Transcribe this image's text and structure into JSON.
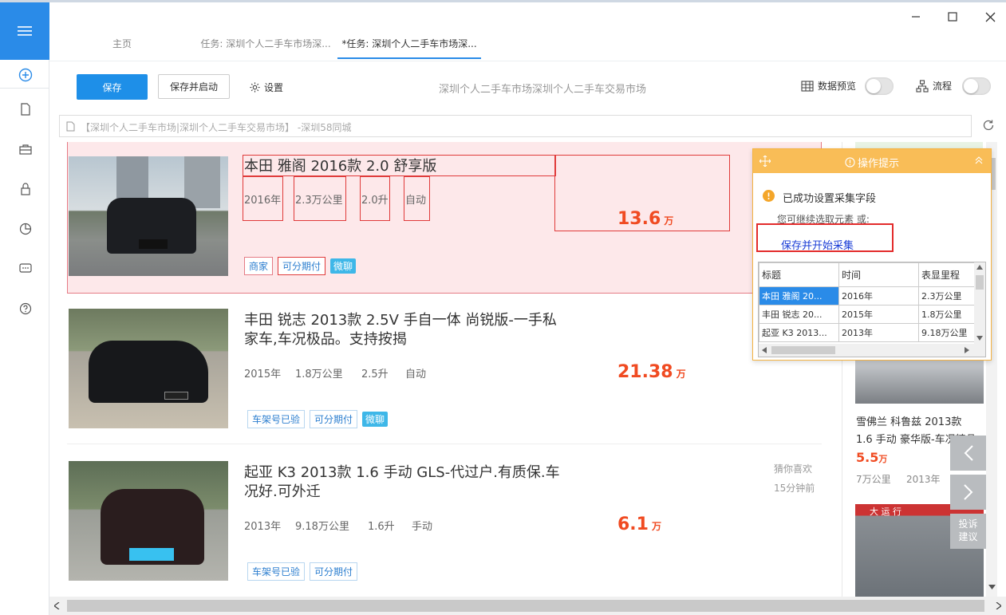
{
  "tabs": {
    "home": "主页",
    "task1": "任务: 深圳个人二手车市场深...",
    "task2": "*任务: 深圳个人二手车市场深..."
  },
  "toolbar": {
    "save_label": "保存",
    "save_start_label": "保存并启动",
    "settings_label": "设置",
    "title": "深圳个人二手车市场深圳个人二手车交易市场",
    "data_preview_label": "数据预览",
    "flow_label": "流程"
  },
  "address": {
    "url_text": "【深圳个人二手车市场|深圳个人二手车交易市场】 -深圳58同城"
  },
  "listings": [
    {
      "title": "本田 雅阁 2016款 2.0 舒享版",
      "year": "2016年",
      "mileage": "2.3万公里",
      "engine": "2.0升",
      "transmission": "自动",
      "price": "13.6",
      "price_unit": "万",
      "tags": [
        "商家",
        "可分期付"
      ],
      "wechat": "微聊"
    },
    {
      "title_line1": "丰田 锐志 2013款 2.5V 手自一体 尚锐版-一手私",
      "title_line2": "家车,车况极品。支持按揭",
      "year": "2015年",
      "mileage": "1.8万公里",
      "engine": "2.5升",
      "transmission": "自动",
      "price": "21.38",
      "price_unit": "万",
      "tags": [
        "车架号已验",
        "可分期付"
      ],
      "wechat": "微聊"
    },
    {
      "title_line1": "起亚 K3 2013款 1.6 手动 GLS-代过户.有质保.车",
      "title_line2": "况好.可外迁",
      "year": "2013年",
      "mileage": "9.18万公里",
      "engine": "1.6升",
      "transmission": "手动",
      "price": "6.1",
      "price_unit": "万",
      "tags": [
        "车架号已验",
        "可分期付"
      ],
      "side_note1": "猜你喜欢",
      "side_note2": "15分钟前"
    }
  ],
  "right_column": {
    "card_title_line1": "雪佛兰 科鲁兹 2013款",
    "card_title_line2": "1.6 手动 豪华版-车况精品",
    "card_price": "5.5",
    "card_price_unit": "万",
    "card_mileage": "7万公里",
    "card_year": "2013年",
    "complaint_line1": "投诉",
    "complaint_line2": "建议",
    "shop_sign": "大 运 行"
  },
  "hint_panel": {
    "header": "操作提示",
    "success": "已成功设置采集字段",
    "continue_text": "您可继续选取元素 或:",
    "action_link": "保存并开始采集",
    "columns": [
      "标题",
      "时间",
      "表显里程"
    ],
    "rows": [
      [
        "本田 雅阁 20...",
        "2016年",
        "2.3万公里"
      ],
      [
        "丰田 锐志 20...",
        "2015年",
        "1.8万公里"
      ],
      [
        "起亚 K3 2013...",
        "2013年",
        "9.18万公里"
      ]
    ]
  },
  "colors": {
    "accent": "#2a8be8",
    "price": "#f04b22",
    "hint_header": "#f9bd57",
    "highlight_fill": "#fde8ea",
    "highlight_border": "#e03a3a"
  }
}
